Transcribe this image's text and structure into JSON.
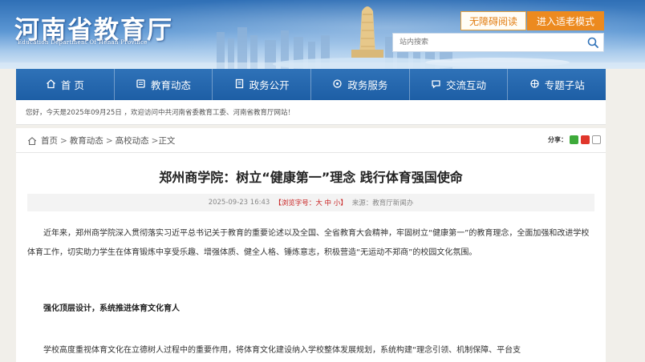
{
  "header": {
    "logo_cn": "河南省教育厅",
    "logo_en": "Education Department Of Henan Province",
    "accessibility_label": "无障碍阅读",
    "elder_mode_label": "进入适老模式",
    "search_placeholder": "站内搜索"
  },
  "nav": {
    "items": [
      {
        "label": "首 页",
        "icon": "home-icon"
      },
      {
        "label": "教育动态",
        "icon": "news-icon"
      },
      {
        "label": "政务公开",
        "icon": "document-icon"
      },
      {
        "label": "政务服务",
        "icon": "service-icon"
      },
      {
        "label": "交流互动",
        "icon": "chat-icon"
      },
      {
        "label": "专题子站",
        "icon": "topic-icon"
      }
    ]
  },
  "welcome": "您好，今天是2025年09月25日 ，欢迎访问中共河南省委教育工委、河南省教育厅网站！",
  "breadcrumb": {
    "home": "首页",
    "level1": "教育动态",
    "level2": "高校动态",
    "current": "正文",
    "sep": ">",
    "sep_last": ">"
  },
  "share": {
    "label": "分享："
  },
  "article": {
    "title": "郑州商学院：树立“健康第一”理念 践行体育强国使命",
    "date": "2025-09-23 16:43",
    "font_prefix": "【浏览字号：",
    "font_large": "大",
    "font_mid": "中",
    "font_small": "小",
    "font_suffix": "】",
    "source": "来源：教育厅新闻办",
    "para1": "近年来，郑州商学院深入贯彻落实习近平总书记关于教育的重要论述以及全国、全省教育大会精神，牢固树立“健康第一”的教育理念，全面加强和改进学校体育工作，切实助力学生在体育锻炼中享受乐趣、增强体质、健全人格、锤炼意志，积极营造“无运动不郑商”的校园文化氛围。",
    "para2": "强化顶层设计，系统推进体育文化育人",
    "para3": "学校高度重视体育文化在立德树人过程中的重要作用，将体育文化建设纳入学校整体发展规划，系统构建“理念引领、机制保障、平台支"
  },
  "colors": {
    "nav_blue": "#1d5ea5",
    "accent_orange": "#ec8a1f",
    "alert_red": "#c82020"
  }
}
